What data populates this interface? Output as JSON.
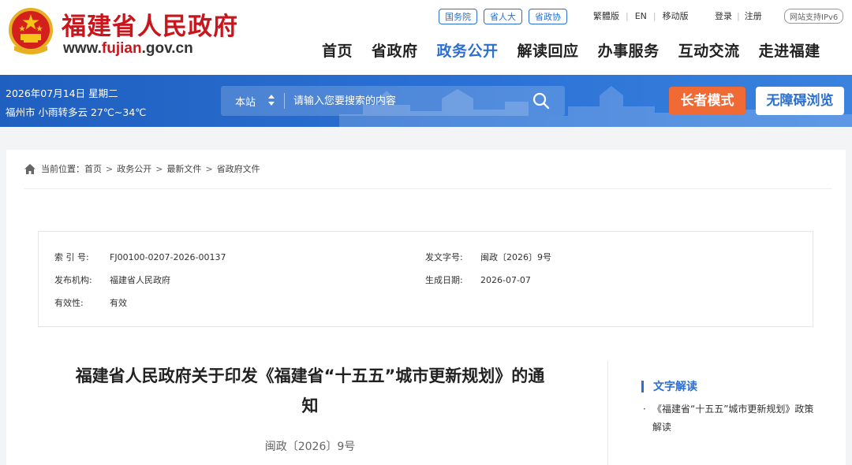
{
  "header": {
    "site_name": "福建省人民政府",
    "url_prefix": "www.",
    "url_highlight": "fujian",
    "url_suffix": ".gov.cn",
    "top_links": [
      "国务院",
      "省人大",
      "省政协"
    ],
    "util_links": [
      "繁體版",
      "EN",
      "移动版"
    ],
    "login_label": "登录",
    "register_label": "注册",
    "ipv6_label": "网站支持IPv6",
    "nav": [
      {
        "label": "首页"
      },
      {
        "label": "省政府"
      },
      {
        "label": "政务公开"
      },
      {
        "label": "解读回应"
      },
      {
        "label": "办事服务"
      },
      {
        "label": "互动交流"
      },
      {
        "label": "走进福建"
      }
    ],
    "nav_active_index": 2
  },
  "bluebar": {
    "date": "2026年07月14日 星期二",
    "weather": "福州市 小雨转多云 27℃~34℃",
    "search_scope": "本站",
    "search_placeholder": "请输入您要搜索的内容",
    "elder_mode_label": "长者模式",
    "accessible_label": "无障碍浏览"
  },
  "breadcrumb": {
    "prefix": "当前位置：",
    "items": [
      "首页",
      "政务公开",
      "最新文件",
      "省政府文件"
    ]
  },
  "meta": {
    "index_label": "索 引 号:",
    "index_value": "FJ00100-0207-2026-00137",
    "doc_label": "发文字号:",
    "doc_value": "闽政〔2026〕9号",
    "org_label": "发布机构:",
    "org_value": "福建省人民政府",
    "date_label": "生成日期:",
    "date_value": "2026-07-07",
    "validity_label": "有效性:",
    "validity_value": "有效"
  },
  "article": {
    "title_line1": "福建省人民政府关于印发《福建省“十五五”城市更新规划》的通",
    "title_line2": "知",
    "doc_number": "闽政〔2026〕9号"
  },
  "sidebar": {
    "heading": "文字解读",
    "items": [
      {
        "text": "《福建省“十五五”城市更新规划》政策解读"
      }
    ]
  },
  "colors": {
    "brand_red": "#c8161d",
    "accent_blue": "#2b6fd1",
    "elder_orange": "#f06a36"
  }
}
